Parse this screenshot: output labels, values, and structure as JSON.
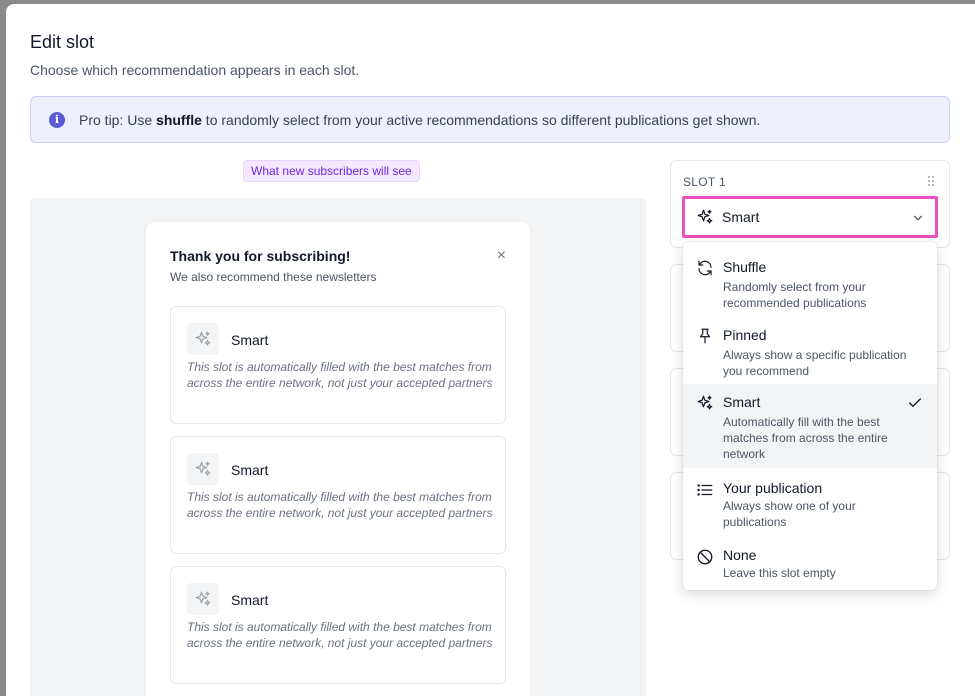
{
  "modal": {
    "title": "Edit slot",
    "subtitle": "Choose which recommendation appears in each slot."
  },
  "tip": {
    "prefix": "Pro tip: Use ",
    "keyword": "shuffle",
    "suffix": " to randomly select from your active recommendations so different publications get shown."
  },
  "preview": {
    "badge": "What new subscribers will see",
    "card_title": "Thank you for subscribing!",
    "card_subtitle": "We also recommend these newsletters",
    "close": "×",
    "items": [
      {
        "name": "Smart",
        "desc": "This slot is automatically filled with the best matches from across the entire network, not just your accepted partners"
      },
      {
        "name": "Smart",
        "desc": "This slot is automatically filled with the best matches from across the entire network, not just your accepted partners"
      },
      {
        "name": "Smart",
        "desc": "This slot is automatically filled with the best matches from across the entire network, not just your accepted partners"
      }
    ]
  },
  "slot": {
    "label": "SLOT 1",
    "selected": "Smart"
  },
  "menu": {
    "options": [
      {
        "label": "Shuffle",
        "desc": "Randomly select from your recommended publications",
        "icon": "refresh-icon"
      },
      {
        "label": "Pinned",
        "desc": "Always show a specific publication you recommend",
        "icon": "pin-icon"
      },
      {
        "label": "Smart",
        "desc": "Automatically fill with the best matches from across the entire network",
        "icon": "sparkles-icon",
        "selected": true
      },
      {
        "label": "Your publication",
        "desc": "Always show one of your publications",
        "icon": "list-icon"
      },
      {
        "label": "None",
        "desc": "Leave this slot empty",
        "icon": "ban-icon"
      }
    ]
  },
  "colors": {
    "accent": "#ec4fbf",
    "tip_bg": "#eef0fd",
    "info": "#5b5bd6",
    "badge_text": "#6d28d9"
  }
}
